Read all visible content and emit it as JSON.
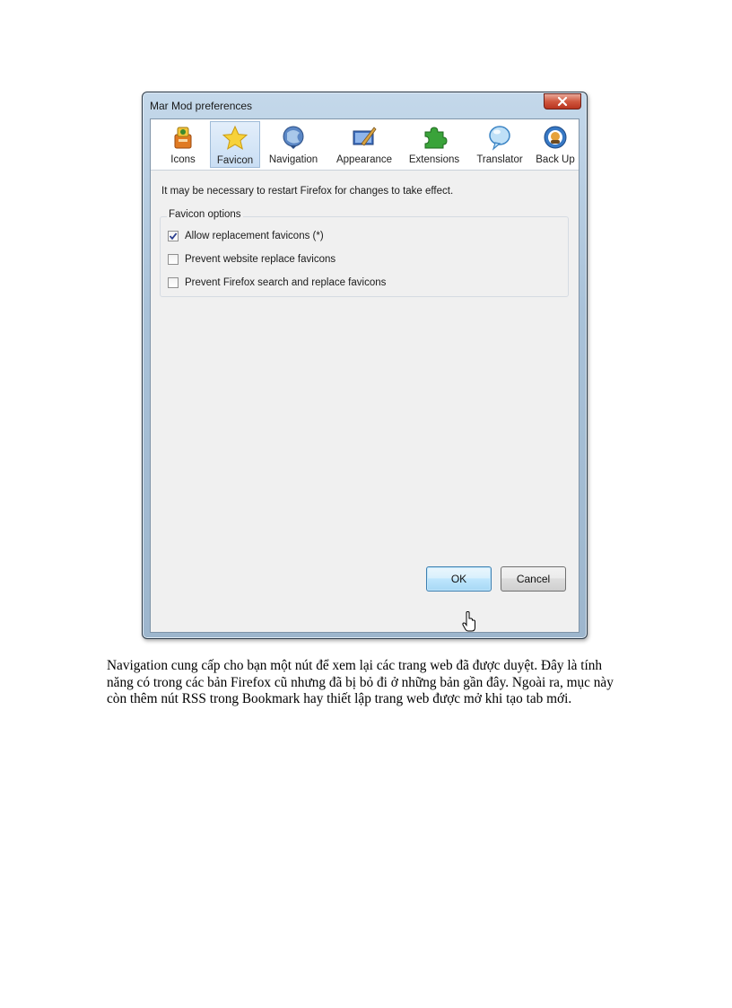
{
  "dialog": {
    "title": "Mar Mod preferences",
    "tabs": [
      {
        "label": "Icons",
        "icon": "icons-icon"
      },
      {
        "label": "Favicon",
        "icon": "star-icon",
        "selected": true
      },
      {
        "label": "Navigation",
        "icon": "navigation-icon"
      },
      {
        "label": "Appearance",
        "icon": "appearance-icon"
      },
      {
        "label": "Extensions",
        "icon": "puzzle-icon"
      },
      {
        "label": "Translator",
        "icon": "speech-bubble-icon"
      },
      {
        "label": "Back Up",
        "icon": "backup-icon"
      }
    ],
    "notice": "It may be necessary to restart Firefox for changes to take effect.",
    "group_title": "Favicon options",
    "options": [
      {
        "label": "Allow replacement favicons (*)",
        "checked": true
      },
      {
        "label": "Prevent website replace favicons",
        "checked": false
      },
      {
        "label": "Prevent Firefox search and replace favicons",
        "checked": false
      }
    ],
    "ok_label": "OK",
    "cancel_label": "Cancel"
  },
  "paragraph": "Navigation cung cấp cho bạn một nút để xem lại các trang web đã được duyệt. Đây là tính năng có trong các bản Firefox cũ nhưng đã bị bỏ đi ở những bản gần đây. Ngoài ra, mục này còn thêm nút RSS trong Bookmark hay thiết lập trang web được mở khi tạo tab mới."
}
